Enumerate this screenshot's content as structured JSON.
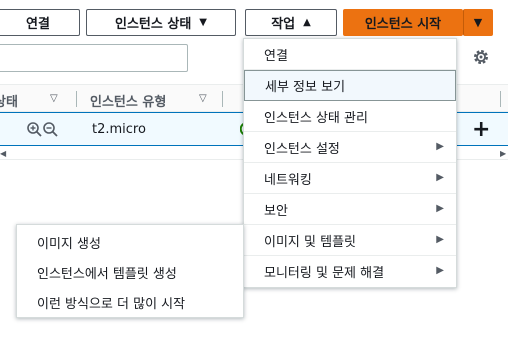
{
  "toolbar": {
    "connect_label": "연결",
    "instance_state_label": "인스턴스 상태",
    "actions_label": "작업",
    "launch_label": "인스턴스 시작"
  },
  "table": {
    "columns": [
      "상태",
      "인스턴스 유형"
    ],
    "row": {
      "instance_type": "t2.micro"
    }
  },
  "actions_menu": {
    "items": [
      {
        "label": "연결",
        "has_submenu": false
      },
      {
        "label": "세부 정보 보기",
        "has_submenu": false,
        "selected": true
      },
      {
        "label": "인스턴스 상태 관리",
        "has_submenu": false
      },
      {
        "label": "인스턴스 설정",
        "has_submenu": true
      },
      {
        "label": "네트워킹",
        "has_submenu": true
      },
      {
        "label": "보안",
        "has_submenu": true
      },
      {
        "label": "이미지 및 템플릿",
        "has_submenu": true
      },
      {
        "label": "모니터링 및 문제 해결",
        "has_submenu": true
      }
    ]
  },
  "image_submenu": {
    "items": [
      "이미지 생성",
      "인스턴스에서 템플릿 생성",
      "이런 방식으로 더 많이 시작"
    ]
  },
  "colors": {
    "primary": "#ec7211",
    "selection": "#f1faff",
    "status_green": "#1d8102"
  },
  "icons": [
    "chevron-down-icon",
    "chevron-up-icon",
    "settings-gear-icon",
    "zoom-in-icon",
    "zoom-out-icon",
    "plus-icon",
    "chevron-right-icon",
    "status-running-icon"
  ]
}
